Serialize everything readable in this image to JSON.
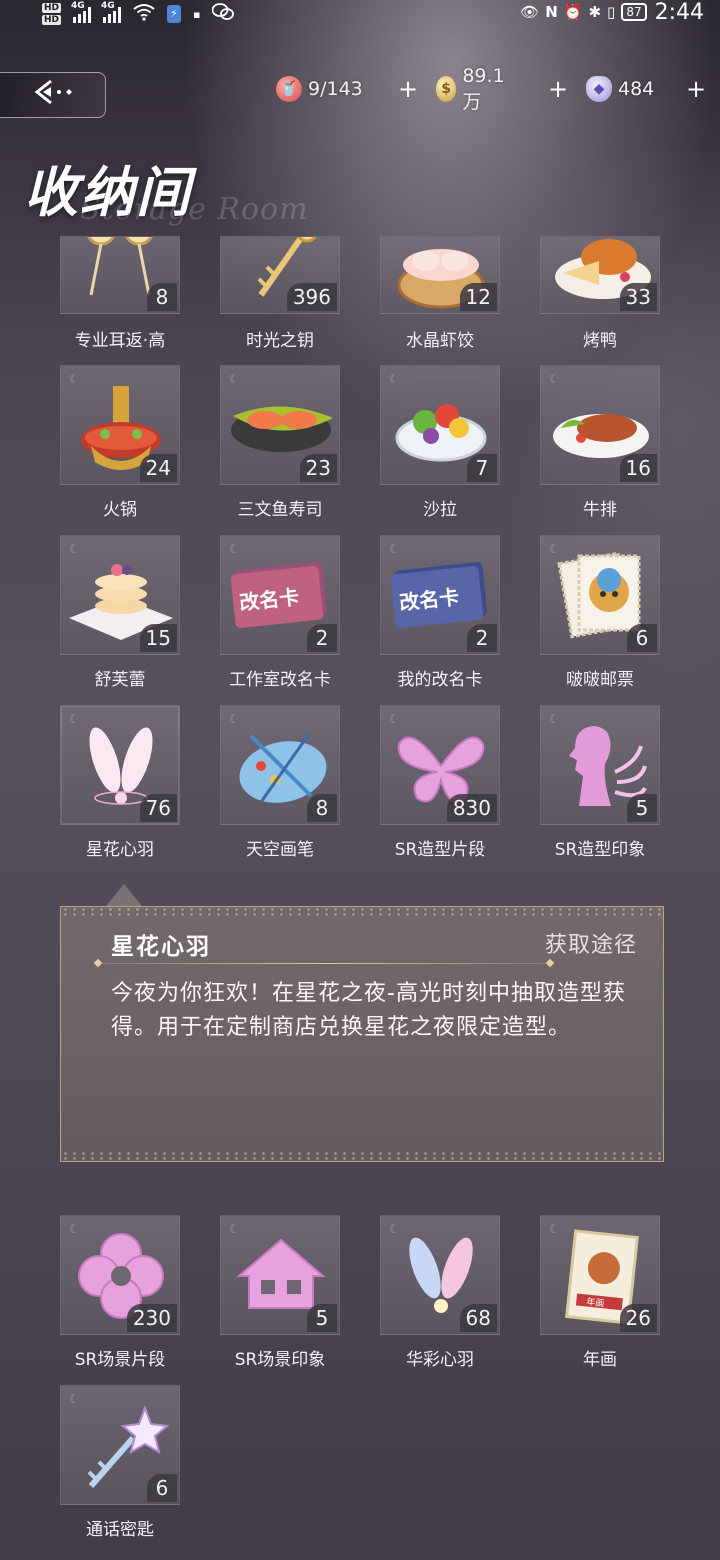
{
  "status_bar": {
    "hd1": "HD",
    "hd2": "HD",
    "net1": "4G",
    "net2": "4G",
    "battery": "87",
    "time": "2:44"
  },
  "header": {
    "title": "收纳间",
    "subtitle": "Storage Room"
  },
  "currencies": [
    {
      "icon": "drink-icon",
      "value": "9/143",
      "plus": "+"
    },
    {
      "icon": "gold-coin-icon",
      "value": "89.1万",
      "plus": "+"
    },
    {
      "icon": "crystal-icon",
      "value": "484",
      "plus": "+"
    }
  ],
  "items": [
    {
      "name": "专业耳返·高",
      "count": "8"
    },
    {
      "name": "时光之钥",
      "count": "396"
    },
    {
      "name": "水晶虾饺",
      "count": "12"
    },
    {
      "name": "烤鸭",
      "count": "33"
    },
    {
      "name": "火锅",
      "count": "24"
    },
    {
      "name": "三文鱼寿司",
      "count": "23"
    },
    {
      "name": "沙拉",
      "count": "7"
    },
    {
      "name": "牛排",
      "count": "16"
    },
    {
      "name": "舒芙蕾",
      "count": "15"
    },
    {
      "name": "工作室改名卡",
      "count": "2"
    },
    {
      "name": "我的改名卡",
      "count": "2"
    },
    {
      "name": "啵啵邮票",
      "count": "6"
    },
    {
      "name": "星花心羽",
      "count": "76"
    },
    {
      "name": "天空画笔",
      "count": "8"
    },
    {
      "name": "SR造型片段",
      "count": "830"
    },
    {
      "name": "SR造型印象",
      "count": "5"
    },
    {
      "name": "SR场景片段",
      "count": "230"
    },
    {
      "name": "SR场景印象",
      "count": "5"
    },
    {
      "name": "华彩心羽",
      "count": "68"
    },
    {
      "name": "年画",
      "count": "26"
    },
    {
      "name": "通话密匙",
      "count": "6"
    }
  ],
  "card_text": {
    "studio": "改名卡",
    "mine": "改名卡",
    "nianhua": "年画"
  },
  "detail": {
    "name": "星花心羽",
    "link": "获取途径",
    "description": "今夜为你狂欢！在星花之夜-高光时刻中抽取造型获得。用于在定制商店兑换星花之夜限定造型。"
  },
  "colors": {
    "panel_border": "#b9a57a",
    "tile_bg": "#78727c",
    "accent_pink": "#d79ad8"
  }
}
